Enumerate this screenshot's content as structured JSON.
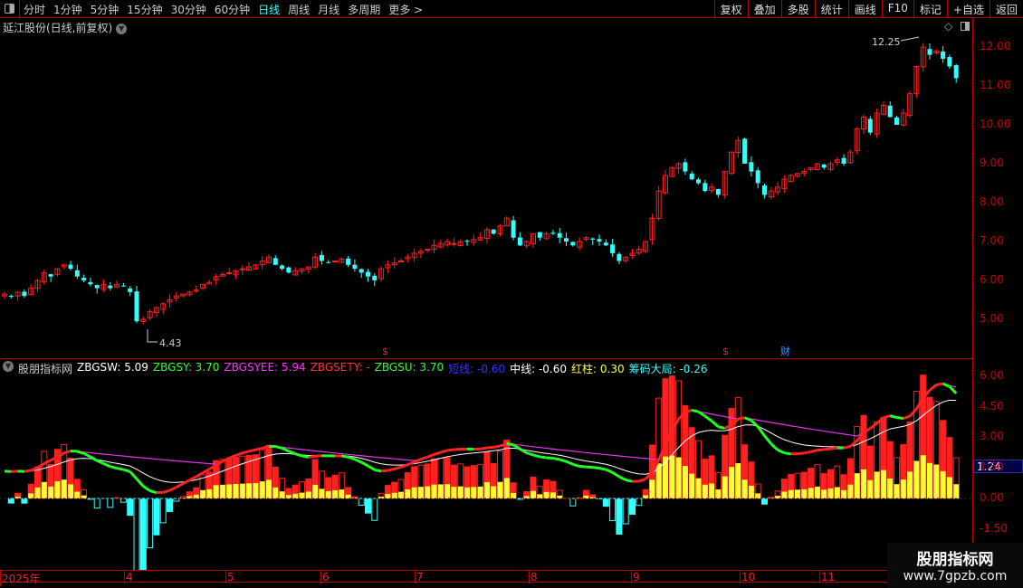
{
  "toolbar": {
    "periods": [
      "分时",
      "1分钟",
      "5分钟",
      "15分钟",
      "30分钟",
      "60分钟",
      "日线",
      "周线",
      "月线",
      "多周期",
      "更多 >"
    ],
    "active_period": "日线",
    "buttons": [
      "复权",
      "叠加",
      "多股",
      "统计",
      "画线",
      "F10",
      "标记",
      "+自选",
      "返回"
    ]
  },
  "stock_title": "延江股份(日线,前复权)",
  "price_axis": [
    "12.00",
    "11.00",
    "10.00",
    "9.00",
    "8.00",
    "7.00",
    "6.00",
    "5.00"
  ],
  "annotations": {
    "high": "12.25",
    "low": "4.43",
    "markers": [
      "$",
      "$",
      "财"
    ]
  },
  "indicator": {
    "name": "股朋指标网",
    "items": [
      {
        "label": "ZBGSW: 5.09",
        "color": "#ffffff"
      },
      {
        "label": "ZBGSY: 3.70",
        "color": "#33ff33"
      },
      {
        "label": "ZBGSYEE: 5.94",
        "color": "#ff33ff"
      },
      {
        "label": "ZBGSETY: -",
        "color": "#ff3333"
      },
      {
        "label": "ZBGSU: 3.70",
        "color": "#33ff33"
      },
      {
        "label": "短线: -0.60",
        "color": "#3333ff"
      },
      {
        "label": "中线: -0.60",
        "color": "#ffffff"
      },
      {
        "label": "红柱: 0.30",
        "color": "#ffff33"
      },
      {
        "label": "筹码大局: -0.26",
        "color": "#33ffff"
      }
    ],
    "axis": [
      "6.00",
      "4.50",
      "3.00",
      "1.50",
      "0.00",
      "-1.50"
    ],
    "highlight_value": "1.24"
  },
  "date_axis": [
    "2025年",
    "4",
    "5",
    "6",
    "7",
    "8",
    "9",
    "10",
    "11"
  ],
  "watermark": {
    "title": "股朋指标网",
    "url": "www.7gpzb.com"
  },
  "colors": {
    "up": "#ff2020",
    "down": "#33ffff",
    "accent": "#33ffff",
    "grid": "#bb0000"
  },
  "chart_data": {
    "type": "candlestick",
    "closes": [
      5.65,
      5.6,
      5.7,
      5.6,
      5.8,
      6.0,
      6.2,
      6.1,
      6.3,
      6.4,
      6.3,
      6.1,
      6.0,
      5.9,
      5.8,
      5.9,
      5.8,
      5.9,
      5.85,
      5.7,
      4.95,
      5.0,
      5.2,
      5.3,
      5.4,
      5.5,
      5.6,
      5.65,
      5.7,
      5.75,
      5.9,
      5.95,
      6.1,
      6.15,
      6.2,
      6.25,
      6.3,
      6.35,
      6.4,
      6.5,
      6.6,
      6.4,
      6.3,
      6.2,
      6.25,
      6.3,
      6.35,
      6.6,
      6.5,
      6.45,
      6.5,
      6.55,
      6.4,
      6.3,
      6.2,
      6.1,
      6.0,
      6.3,
      6.4,
      6.45,
      6.5,
      6.6,
      6.7,
      6.75,
      6.8,
      6.9,
      6.95,
      7.0,
      6.95,
      7.0,
      7.0,
      7.05,
      7.1,
      7.3,
      7.2,
      7.4,
      7.6,
      7.1,
      6.9,
      7.0,
      7.2,
      7.1,
      7.2,
      7.2,
      7.1,
      7.0,
      6.9,
      7.0,
      7.1,
      7.05,
      7.0,
      6.9,
      6.7,
      6.5,
      6.6,
      6.7,
      6.8,
      7.0,
      7.6,
      8.3,
      8.7,
      8.9,
      9.0,
      8.8,
      8.6,
      8.5,
      8.3,
      8.4,
      8.2,
      8.8,
      9.3,
      9.6,
      9.0,
      8.8,
      8.5,
      8.2,
      8.3,
      8.4,
      8.6,
      8.7,
      8.75,
      8.8,
      8.9,
      9.0,
      8.9,
      9.0,
      9.1,
      9.0,
      9.3,
      9.9,
      10.2,
      9.8,
      10.3,
      10.5,
      10.2,
      10.0,
      10.3,
      10.8,
      11.5,
      12.0,
      11.8,
      11.9,
      11.7,
      11.5,
      11.2
    ],
    "ylim": [
      4.4,
      12.3
    ]
  }
}
